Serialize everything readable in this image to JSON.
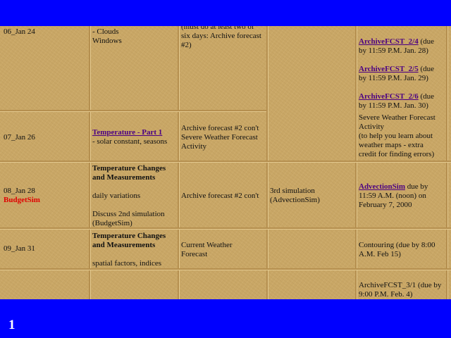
{
  "page_number": "1",
  "rows": [
    {
      "date": "06_Jan 24",
      "topic_lines": [
        "- Clouds",
        "Windows"
      ],
      "lab_lines": [
        "(must do at least two of",
        "six days: Archive forecast",
        "#2)"
      ],
      "assignments": [
        {
          "link": "ArchiveFCST_2/4",
          "text_lines": [
            "(due",
            "by 11:59 P.M. Jan. 28)"
          ]
        },
        {
          "link": "ArchiveFCST_2/5",
          "text_lines": [
            "(due",
            "by 11:59 P.M. Jan. 29)"
          ]
        },
        {
          "link": "ArchiveFCST_2/6",
          "text_lines": [
            "(due",
            "by 11:59 P.M. Jan. 30)"
          ]
        }
      ]
    },
    {
      "date": "07_Jan 26",
      "topic_link": "Temperature - Part 1",
      "topic_lines": [
        "- solar constant, seasons"
      ],
      "lab_lines": [
        "Archive forecast #2 con't",
        "Severe Weather Forecast",
        "Activity"
      ],
      "assignment_lines": [
        "Severe Weather Forecast",
        "Activity",
        "(to help you learn about",
        "weather maps - extra",
        "credit for finding errors)"
      ]
    },
    {
      "date": "08_Jan 28",
      "date_note": "BudgetSim",
      "topic_lines": [
        "Temperature Changes",
        "and Measurements"
      ],
      "topic_detail_1": "daily variations",
      "topic_detail_2": [
        "Discuss 2nd simulation",
        "(BudgetSim)"
      ],
      "lab_lines": [
        "Archive forecast #2 con't"
      ],
      "simulation_lines": [
        "3rd simulation",
        "(AdvectionSim)"
      ],
      "assignment_link": "AdvectionSim",
      "assignment_lines": [
        "due by",
        "11:59 A.M. (noon) on",
        "February 7, 2000"
      ]
    },
    {
      "date": "09_Jan 31",
      "topic_lines": [
        "Temperature Changes",
        "and Measurements"
      ],
      "topic_detail_1": "spatial factors, indices",
      "lab_lines": [
        "Current Weather",
        "Forecast"
      ],
      "assignment_lines": [
        "Contouring (due by 8:00",
        "A.M. Feb 15)"
      ]
    },
    {
      "assignment_lines": [
        "ArchiveFCST_3/1 (due by",
        "9:00 P.M. Feb. 4)"
      ]
    }
  ]
}
